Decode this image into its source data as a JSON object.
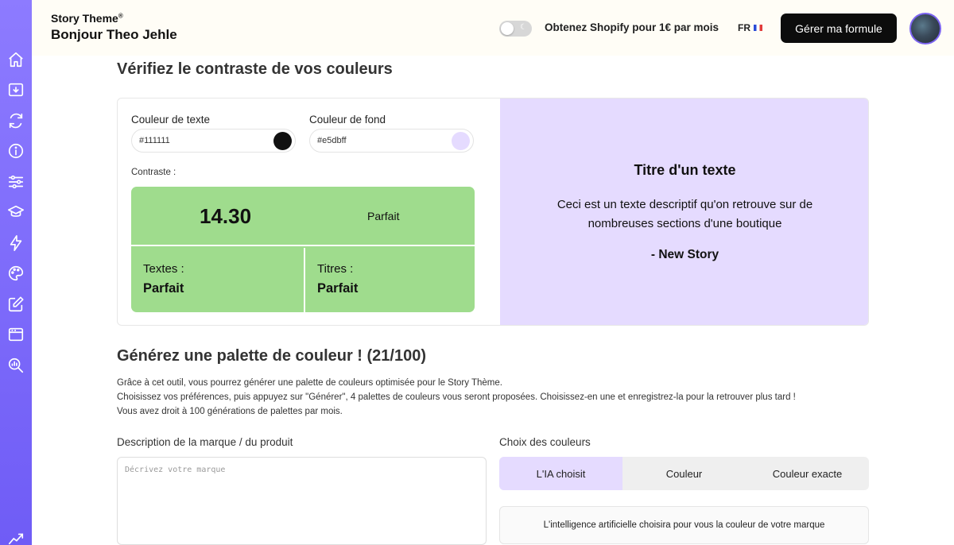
{
  "header": {
    "brand": "Story Theme",
    "brand_mark": "®",
    "greeting": "Bonjour Theo Jehle",
    "promo": "Obtenez Shopify pour 1€ par mois",
    "language": "FR",
    "plan_button": "Gérer ma formule"
  },
  "sidebar": {
    "icons": [
      "home-icon",
      "download-icon",
      "refresh-icon",
      "info-icon",
      "settings-sliders-icon",
      "graduation-cap-icon",
      "lightning-icon",
      "palette-icon",
      "edit-icon",
      "browser-window-icon",
      "search-chart-icon",
      "trending-up-icon"
    ]
  },
  "contrast": {
    "title": "Vérifiez le contraste de vos couleurs",
    "text_color_label": "Couleur de texte",
    "text_color_value": "#111111",
    "background_color_label": "Couleur de fond",
    "background_color_value": "#e5dbff",
    "contrast_label": "Contraste :",
    "ratio": "14.30",
    "ratio_verdict": "Parfait",
    "texts_label": "Textes :",
    "texts_verdict": "Parfait",
    "titles_label": "Titres :",
    "titles_verdict": "Parfait",
    "result_color": "#9fdc8d"
  },
  "preview": {
    "title": "Titre d'un texte",
    "description": "Ceci est un texte descriptif qu'on retrouve sur de nombreuses sections d'une boutique",
    "signature": "- New Story"
  },
  "palette": {
    "title": "Générez une palette de couleur ! (21/100)",
    "intro_lines": [
      "Grâce à cet outil, vous pourrez générer une palette de couleurs optimisée pour le Story Thème.",
      "Choisissez vos préférences, puis appuyez sur \"Générer\", 4 palettes de couleurs vous seront proposées. Choisissez-en une et enregistrez-la pour la retrouver plus tard !",
      "Vous avez droit à 100 générations de palettes par mois."
    ],
    "description_label": "Description de la marque / du produit",
    "description_placeholder": "Décrivez votre marque",
    "color_choice_label": "Choix des couleurs",
    "options": [
      "L'IA choisit",
      "Couleur",
      "Couleur exacte"
    ],
    "ai_note": "L'intelligence artificielle choisira pour vous la couleur de votre marque"
  },
  "accent_color": "#7b63f0"
}
